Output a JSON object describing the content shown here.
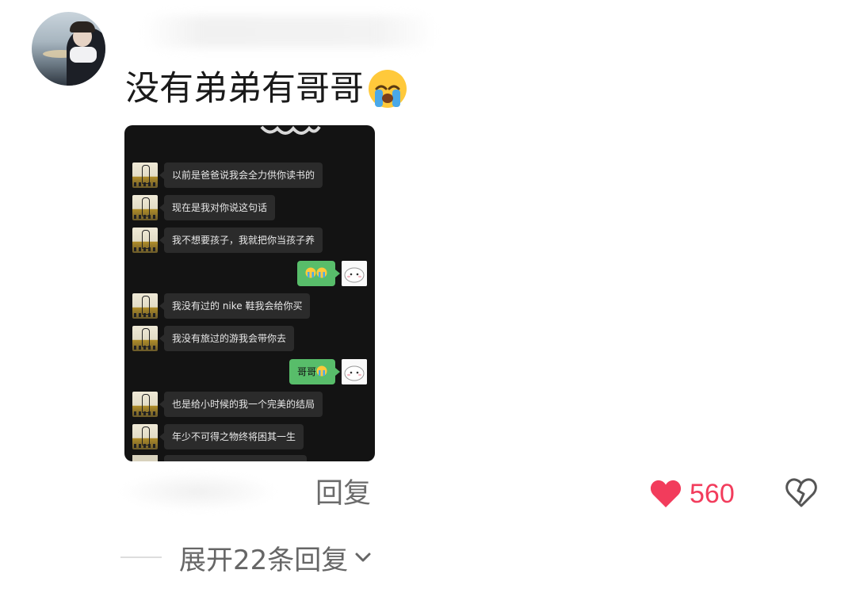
{
  "comment": {
    "text": "没有弟弟有哥哥",
    "emoji": "loudly-crying-face"
  },
  "chat_screenshot": {
    "messages": [
      {
        "side": "left",
        "text": "以前是爸爸说我会全力供你读书的"
      },
      {
        "side": "left",
        "text": "现在是我对你说这句话"
      },
      {
        "side": "left",
        "text": "我不想要孩子，我就把你当孩子养"
      },
      {
        "side": "right",
        "text": "",
        "emoji": "crying-face x2"
      },
      {
        "side": "left",
        "text": "我没有过的 nike 鞋我会给你买"
      },
      {
        "side": "left",
        "text": "我没有旅过的游我会带你去"
      },
      {
        "side": "right",
        "text": "哥哥",
        "emoji": "crying-face"
      },
      {
        "side": "left",
        "text": "也是给小时候的我一个完美的结局"
      },
      {
        "side": "left",
        "text": "年少不可得之物终将困其一生"
      }
    ]
  },
  "actions": {
    "reply_label": "回复",
    "like_count": "560",
    "like_color": "#f23c5c"
  },
  "expand": {
    "label": "展开22条回复"
  }
}
